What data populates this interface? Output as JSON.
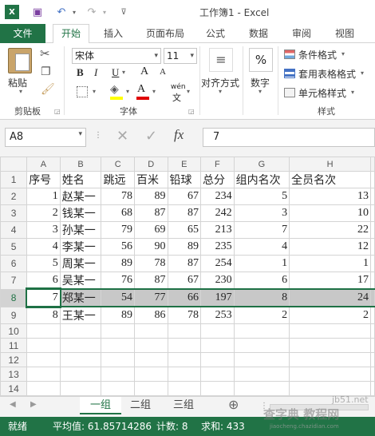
{
  "window": {
    "title": "工作簿1 - Excel"
  },
  "tabs": [
    {
      "label": "文件"
    },
    {
      "label": "开始"
    },
    {
      "label": "插入"
    },
    {
      "label": "页面布局"
    },
    {
      "label": "公式"
    },
    {
      "label": "数据"
    },
    {
      "label": "审阅"
    },
    {
      "label": "视图"
    }
  ],
  "ribbon": {
    "clipboard": {
      "paste": "粘贴",
      "group": "剪贴板"
    },
    "font": {
      "name": "宋体",
      "size": "11",
      "bold": "B",
      "italic": "I",
      "underline": "U",
      "grow": "A",
      "shrink": "A",
      "font_color": "A",
      "wen": "wén",
      "group": "字体"
    },
    "align": {
      "label": "对齐方式"
    },
    "number": {
      "label": "数字",
      "symbol": "%"
    },
    "styles": {
      "cond": "条件格式",
      "table": "套用表格格式",
      "cell": "单元格样式",
      "group": "样式"
    },
    "colors": {
      "accent": "#217346"
    }
  },
  "formula_bar": {
    "name_box": "A8",
    "fx": "fx",
    "value": "7"
  },
  "columns": [
    "A",
    "B",
    "C",
    "D",
    "E",
    "F",
    "G",
    "H"
  ],
  "rows": [
    {
      "n": "1",
      "c": [
        "序号",
        "姓名",
        "跳远",
        "百米",
        "铅球",
        "总分",
        "组内名次",
        "全员名次"
      ]
    },
    {
      "n": "2",
      "c": [
        "1",
        "赵某一",
        "78",
        "89",
        "67",
        "234",
        "5",
        "13"
      ]
    },
    {
      "n": "3",
      "c": [
        "2",
        "钱某一",
        "68",
        "87",
        "87",
        "242",
        "3",
        "10"
      ]
    },
    {
      "n": "4",
      "c": [
        "3",
        "孙某一",
        "79",
        "69",
        "65",
        "213",
        "7",
        "22"
      ]
    },
    {
      "n": "5",
      "c": [
        "4",
        "李某一",
        "56",
        "90",
        "89",
        "235",
        "4",
        "12"
      ]
    },
    {
      "n": "6",
      "c": [
        "5",
        "周某一",
        "89",
        "78",
        "87",
        "254",
        "1",
        "1"
      ]
    },
    {
      "n": "7",
      "c": [
        "6",
        "吴某一",
        "76",
        "87",
        "67",
        "230",
        "6",
        "17"
      ]
    },
    {
      "n": "8",
      "c": [
        "7",
        "郑某一",
        "54",
        "77",
        "66",
        "197",
        "8",
        "24"
      ]
    },
    {
      "n": "9",
      "c": [
        "8",
        "王某一",
        "89",
        "86",
        "78",
        "253",
        "2",
        "2"
      ]
    },
    {
      "n": "10",
      "c": [
        "",
        "",
        "",
        "",
        "",
        "",
        "",
        ""
      ]
    },
    {
      "n": "11",
      "c": [
        "",
        "",
        "",
        "",
        "",
        "",
        "",
        ""
      ]
    },
    {
      "n": "12",
      "c": [
        "",
        "",
        "",
        "",
        "",
        "",
        "",
        ""
      ]
    },
    {
      "n": "13",
      "c": [
        "",
        "",
        "",
        "",
        "",
        "",
        "",
        ""
      ]
    },
    {
      "n": "14",
      "c": [
        "",
        "",
        "",
        "",
        "",
        "",
        "",
        ""
      ]
    },
    {
      "n": "15",
      "c": [
        "",
        "",
        "",
        "",
        "",
        "",
        "",
        ""
      ]
    },
    {
      "n": "16",
      "c": [
        "",
        "",
        "",
        "",
        "",
        "",
        "",
        ""
      ]
    }
  ],
  "sheets": [
    "一组",
    "二组",
    "三组"
  ],
  "add_sheet": "⊕",
  "status": {
    "ready": "就绪",
    "avg_label": "平均值: 61.85714286",
    "count_label": "计数: 8",
    "sum_label": "求和: 433"
  },
  "watermark": {
    "line1": "查字典 教程网",
    "line2": "jb51.net",
    "line3": "jiaocheng.chazidian.com"
  }
}
